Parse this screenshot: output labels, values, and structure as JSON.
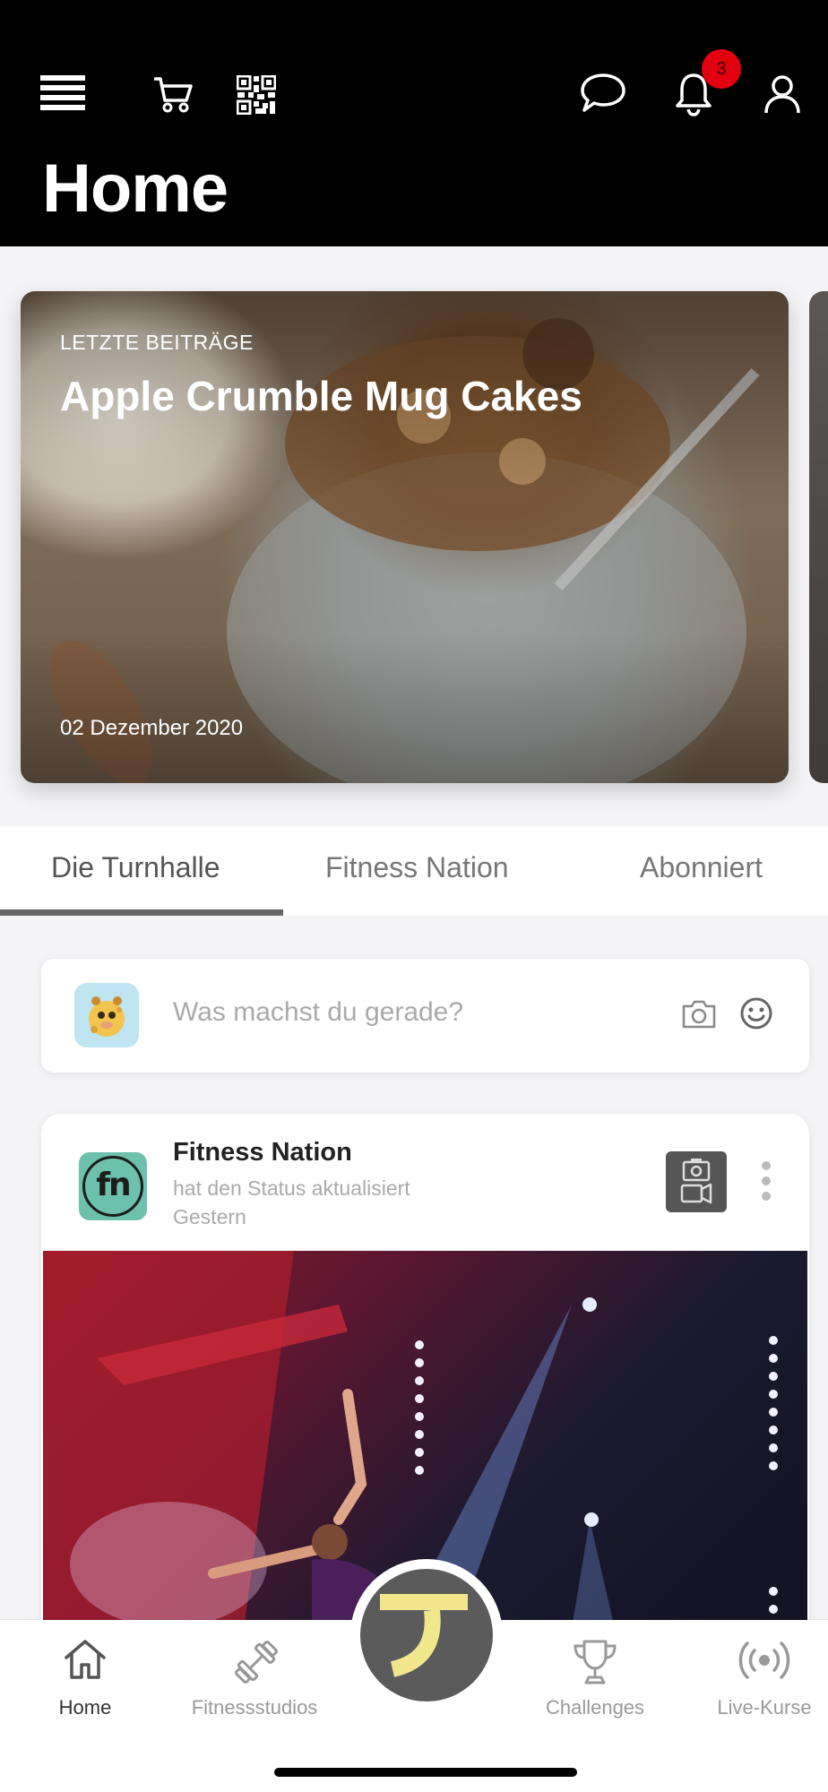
{
  "header": {
    "title": "Home",
    "notification_count": "3",
    "icons": [
      "menu-icon",
      "cart-icon",
      "qr-code-icon",
      "chat-bubble-icon",
      "bell-icon",
      "user-icon"
    ]
  },
  "hero": {
    "eyebrow": "LETZTE BEITRÄGE",
    "title": "Apple Crumble Mug Cakes",
    "date": "02 Dezember 2020"
  },
  "tabs": [
    {
      "label": "Die Turnhalle",
      "active": true
    },
    {
      "label": "Fitness Nation",
      "active": false
    },
    {
      "label": "Abonniert",
      "active": false
    }
  ],
  "composer": {
    "placeholder": "Was machst du gerade?",
    "icons": [
      "camera-icon",
      "smiley-icon"
    ]
  },
  "post": {
    "author": "Fitness Nation",
    "logo_text": "fn",
    "action": "hat den Status aktualisiert",
    "time": "Gestern"
  },
  "bottom_nav": [
    {
      "label": "Home",
      "icon": "home-icon",
      "active": true
    },
    {
      "label": "Fitnessstudios",
      "icon": "dumbbell-icon",
      "active": false
    },
    {
      "label": "Challenges",
      "icon": "trophy-icon",
      "active": false
    },
    {
      "label": "Live-Kurse",
      "icon": "broadcast-icon",
      "active": false
    }
  ],
  "colors": {
    "header_bg": "#000000",
    "badge": "#e3000f",
    "logo_bg": "#6cc1ad",
    "accent_yellow": "#f1e68c"
  }
}
